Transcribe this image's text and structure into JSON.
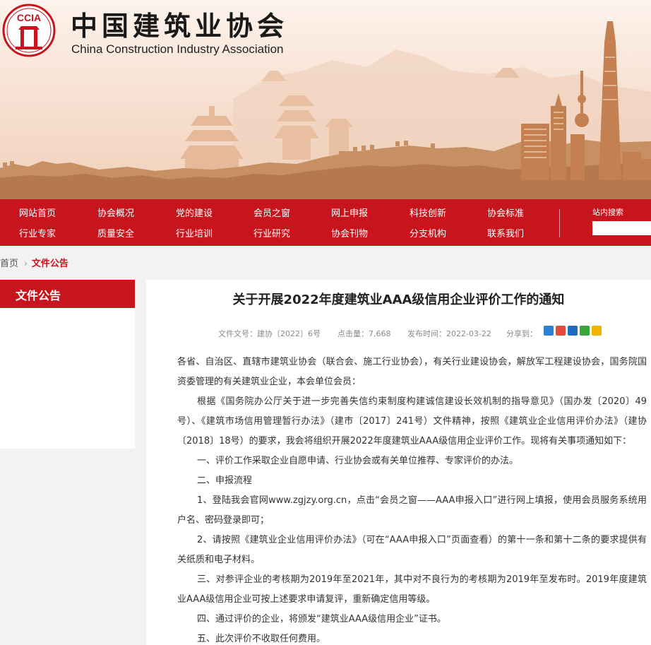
{
  "header": {
    "logo_text": "CCIA",
    "title_cn": "中国建筑业协会",
    "title_en": "China Construction Industry Association"
  },
  "nav": {
    "row1": [
      "网站首页",
      "协会概况",
      "党的建设",
      "会员之窗",
      "网上申报",
      "科技创新",
      "协会标准"
    ],
    "row2": [
      "行业专家",
      "质量安全",
      "行业培训",
      "行业研究",
      "协会刊物",
      "分支机构",
      "联系我们"
    ],
    "search_label": "站内搜索",
    "search_value": ""
  },
  "breadcrumb": {
    "home": "首页",
    "separator": "›",
    "current": "文件公告"
  },
  "sidebar": {
    "title": "文件公告"
  },
  "article": {
    "title": "关于开展2022年度建筑业AAA级信用企业评价工作的通知",
    "meta": {
      "doc_no": "文件文号：建协〔2022〕6号",
      "views": "点击量：7,668",
      "date": "发布时间：2022-03-22",
      "share": "分享到："
    },
    "share_icons": [
      {
        "name": "plus-share-icon",
        "color": "#2f7fd6"
      },
      {
        "name": "weibo-icon",
        "color": "#e34b3c"
      },
      {
        "name": "renren-icon",
        "color": "#1f6bbf"
      },
      {
        "name": "wechat-icon",
        "color": "#3aa63a"
      },
      {
        "name": "qzone-icon",
        "color": "#f0b400"
      }
    ],
    "paragraphs": [
      "各省、自治区、直辖市建筑业协会（联合会、施工行业协会），有关行业建设协会，解放军工程建设协会，国务院国资委管理的有关建筑业企业，本会单位会员：",
      "根据《国务院办公厅关于进一步完善失信约束制度构建诚信建设长效机制的指导意见》（国办发〔2020〕49号）、《建筑市场信用管理暂行办法》（建市〔2017〕241号）文件精神，按照《建筑业企业信用评价办法》（建协〔2018〕18号）的要求，我会将组织开展2022年度建筑业AAA级信用企业评价工作。现将有关事项通知如下：",
      "一、评价工作采取企业自愿申请、行业协会或有关单位推荐、专家评价的办法。",
      "二、申报流程",
      "1、登陆我会官网www.zgjzy.org.cn，点击“会员之窗——AAA申报入口”进行网上填报，使用会员服务系统用户名、密码登录即可；",
      "2、请按照《建筑业企业信用评价办法》（可在“AAA申报入口”页面查看）的第十一条和第十二条的要求提供有关纸质和电子材料。",
      "三、对参评企业的考核期为2019年至2021年，其中对不良行为的考核期为2019年至发布时。2019年度建筑业AAA级信用企业可按上述要求申请复评，重新确定信用等级。",
      "四、通过评价的企业，将颁发“建筑业AAA级信用企业”证书。",
      "五、此次评价不收取任何费用。"
    ]
  }
}
